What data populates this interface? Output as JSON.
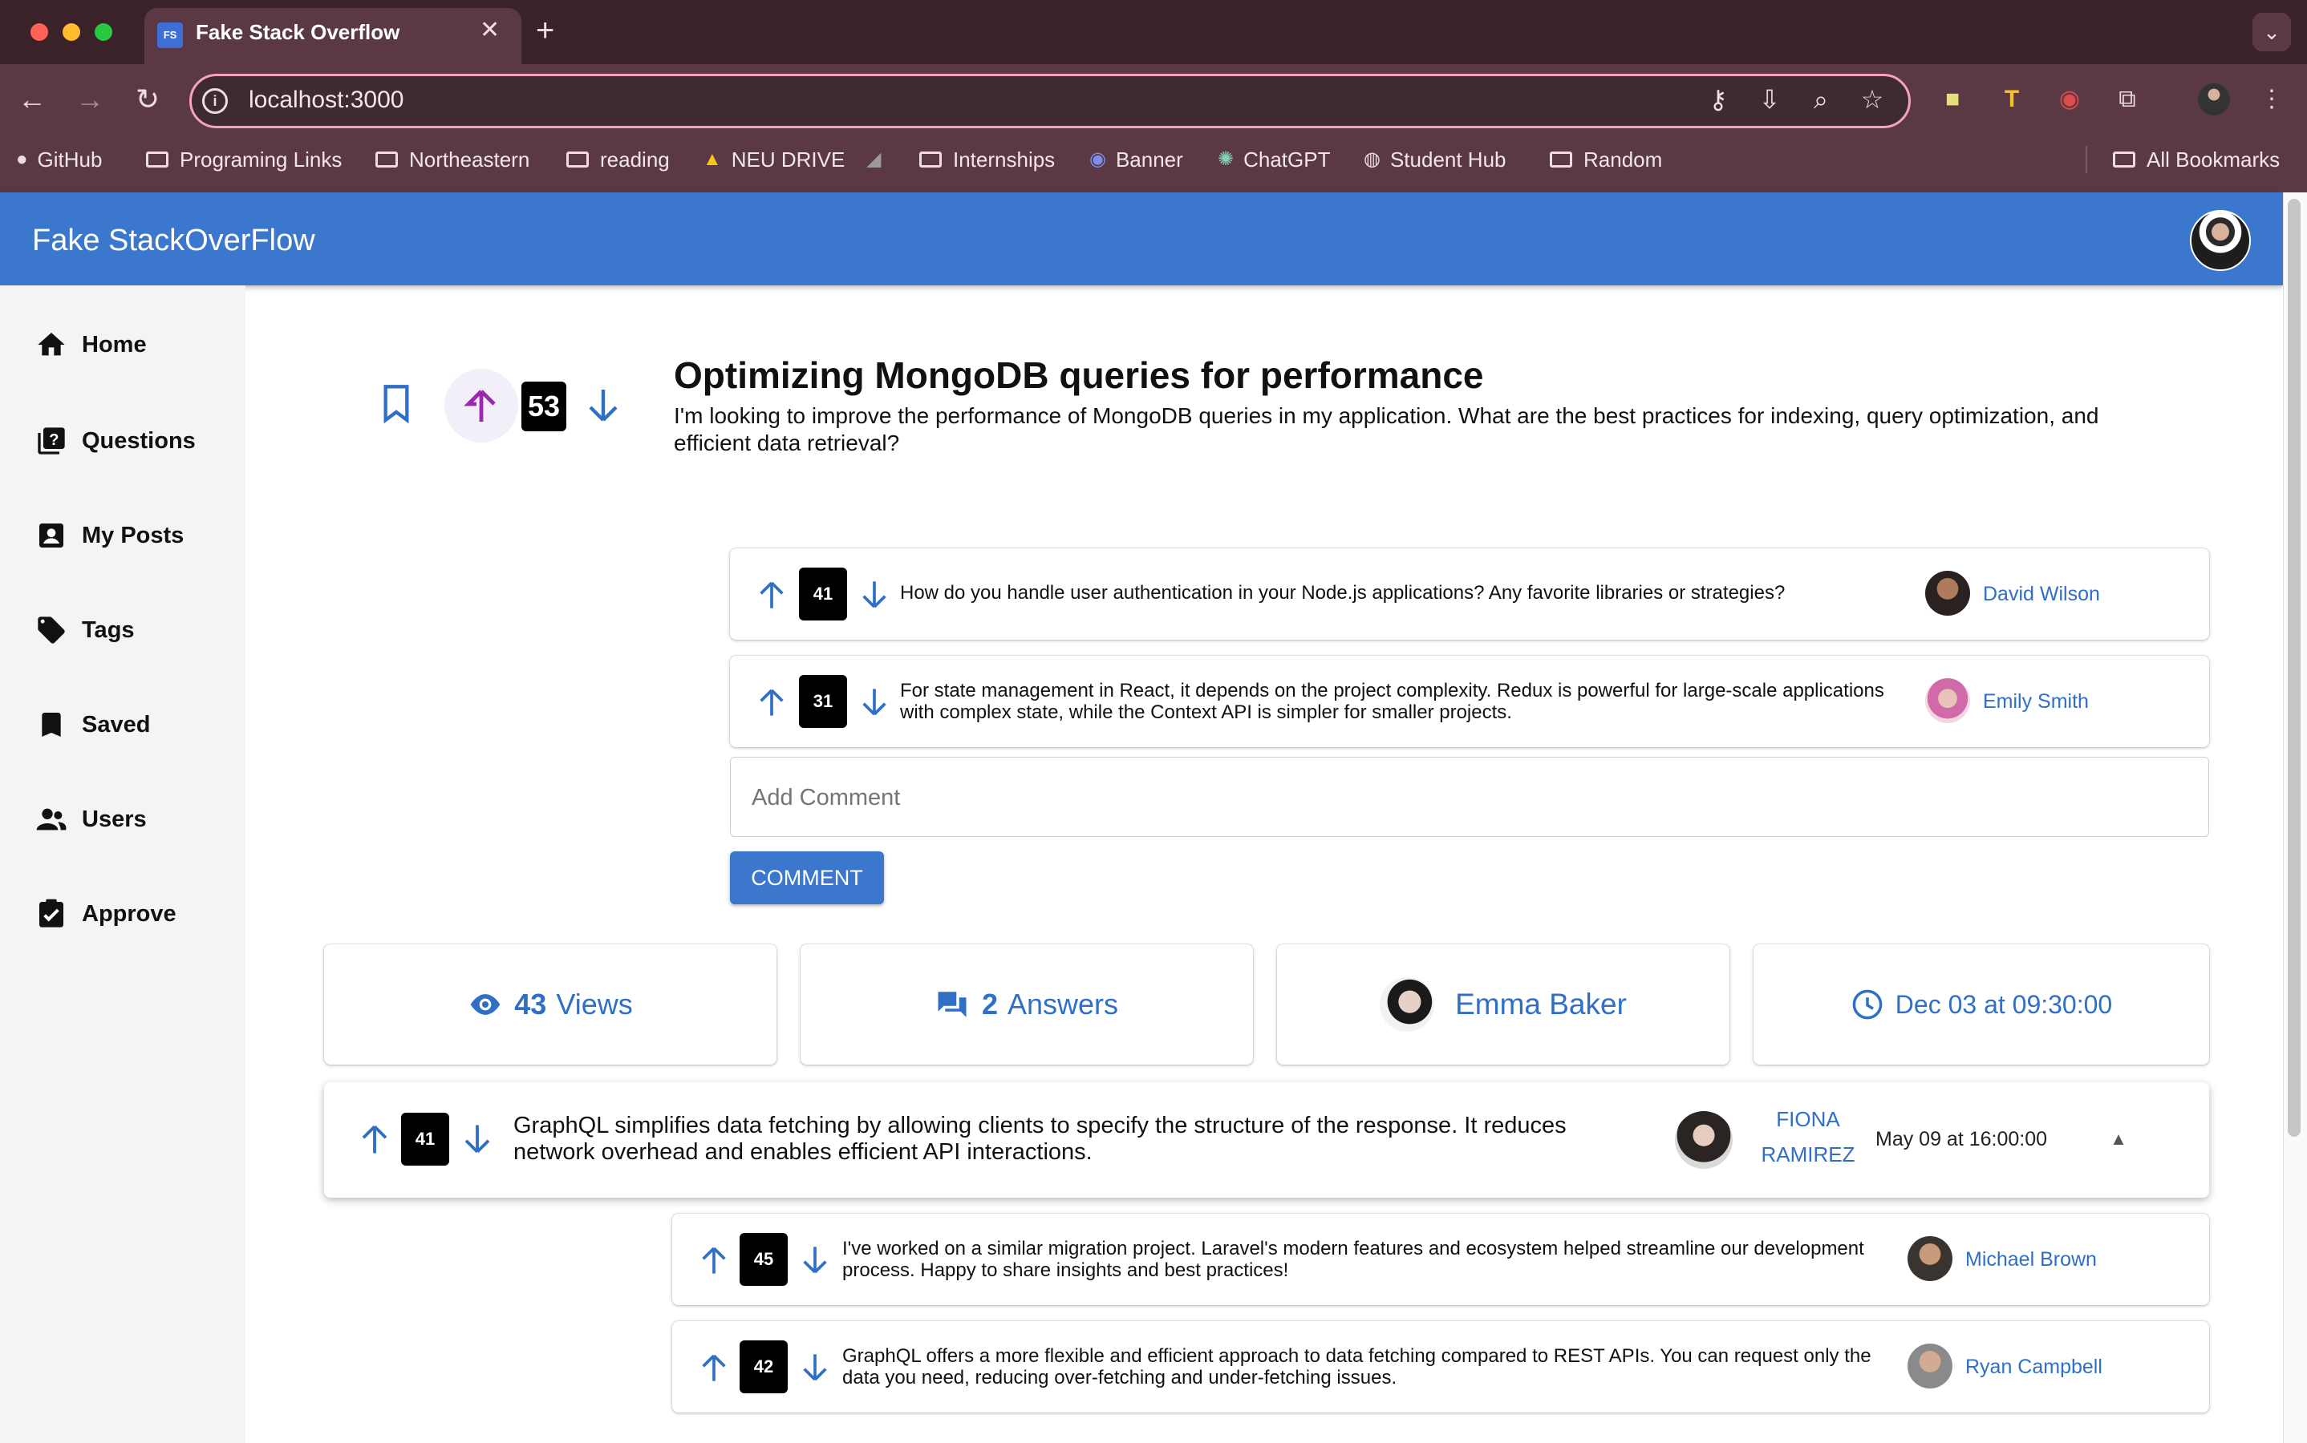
{
  "browser": {
    "tab_title": "Fake Stack Overflow",
    "tab_favicon": "FS",
    "url": "localhost:3000",
    "bookmarks": [
      {
        "label": "GitHub",
        "icon": "github-icon"
      },
      {
        "label": "Programing Links",
        "icon": "folder-icon"
      },
      {
        "label": "Northeastern",
        "icon": "folder-icon"
      },
      {
        "label": "reading",
        "icon": "folder-icon"
      },
      {
        "label": "NEU DRIVE",
        "icon": "drive-icon"
      },
      {
        "label": "Internships",
        "icon": "folder-icon"
      },
      {
        "label": "Banner",
        "icon": "banner-icon"
      },
      {
        "label": "ChatGPT",
        "icon": "chatgpt-icon"
      },
      {
        "label": "Student Hub",
        "icon": "globe-icon"
      },
      {
        "label": "Random",
        "icon": "folder-icon"
      }
    ],
    "all_bookmarks": "All Bookmarks"
  },
  "app": {
    "title": "Fake StackOverFlow"
  },
  "sidebar": {
    "items": [
      {
        "label": "Home",
        "icon": "home-icon"
      },
      {
        "label": "Questions",
        "icon": "questions-icon"
      },
      {
        "label": "My Posts",
        "icon": "account-box-icon"
      },
      {
        "label": "Tags",
        "icon": "tag-icon"
      },
      {
        "label": "Saved",
        "icon": "bookmark-icon"
      },
      {
        "label": "Users",
        "icon": "people-icon"
      },
      {
        "label": "Approve",
        "icon": "clipboard-check-icon"
      }
    ]
  },
  "question": {
    "votes": "53",
    "title": "Optimizing MongoDB queries for performance",
    "text": "I'm looking to improve the performance of MongoDB queries in my application. What are the best practices for indexing, query optimization, and efficient data retrieval?",
    "comments": [
      {
        "votes": "41",
        "text": "How do you handle user authentication in your Node.js applications? Any favorite libraries or strategies?",
        "user": "David Wilson"
      },
      {
        "votes": "31",
        "text": "For state management in React, it depends on the project complexity. Redux is powerful for large-scale applications with complex state, while the Context API is simpler for smaller projects.",
        "user": "Emily Smith"
      }
    ],
    "add_comment_placeholder": "Add Comment",
    "comment_button": "COMMENT",
    "stats": {
      "views": "43",
      "views_label": "Views",
      "answers": "2",
      "answers_label": "Answers",
      "author": "Emma Baker",
      "date": "Dec 03 at 09:30:00"
    }
  },
  "answer": {
    "votes": "41",
    "text": "GraphQL simplifies data fetching by allowing clients to specify the structure of the response. It reduces network overhead and enables efficient API interactions.",
    "user_line1": "FIONA",
    "user_line2": "RAMIREZ",
    "date": "May 09 at 16:00:00",
    "comments": [
      {
        "votes": "45",
        "text": "I've worked on a similar migration project. Laravel's modern features and ecosystem helped streamline our development process. Happy to share insights and best practices!",
        "user": "Michael Brown"
      },
      {
        "votes": "42",
        "text": "GraphQL offers a more flexible and efficient approach to data fetching compared to REST APIs. You can request only the data you need, reducing over-fetching and under-fetching issues.",
        "user": "Ryan Campbell"
      }
    ]
  },
  "colors": {
    "accent": "#3a77cd",
    "upvote_active": "#9c27b0",
    "link": "#2f6fc6"
  }
}
